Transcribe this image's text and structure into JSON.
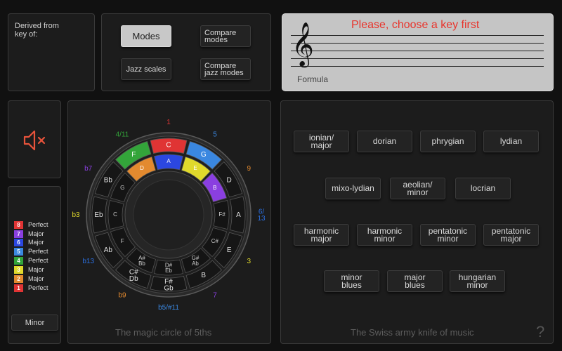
{
  "derived": {
    "label": "Derived from\nkey of:"
  },
  "mode_buttons": {
    "modes": "Modes",
    "compare_modes": "Compare\nmodes",
    "jazz_scales": "Jazz scales",
    "compare_jazz": "Compare\njazz modes"
  },
  "staff": {
    "message": "Please, choose a key first",
    "formula": "Formula",
    "message_color": "#e8342c"
  },
  "legend": {
    "items": [
      {
        "num": "8",
        "label": "Perfect",
        "color": "#e03434"
      },
      {
        "num": "7",
        "label": "Major",
        "color": "#8a3fe0"
      },
      {
        "num": "6",
        "label": "Major",
        "color": "#2b47e0"
      },
      {
        "num": "5",
        "label": "Perfect",
        "color": "#3a87e0"
      },
      {
        "num": "4",
        "label": "Perfect",
        "color": "#33a53a"
      },
      {
        "num": "3",
        "label": "Major",
        "color": "#e0d92c"
      },
      {
        "num": "2",
        "label": "Major",
        "color": "#e38a2f"
      },
      {
        "num": "1",
        "label": "Perfect",
        "color": "#e03434"
      }
    ],
    "minor_button": "Minor"
  },
  "circle": {
    "caption": "The magic circle of 5ths",
    "outer_notes": [
      "C",
      "G",
      "D",
      "A",
      "E",
      "B",
      "F#\nGb",
      "C#\nDb",
      "Ab",
      "Eb",
      "Bb",
      "F"
    ],
    "inner_notes": [
      "A",
      "E",
      "B",
      "F#",
      "C#",
      "G#\nAb",
      "D#\nEb",
      "A#\nBb",
      "F",
      "C",
      "G",
      "D"
    ],
    "intervals": [
      "1",
      "5",
      "9",
      "6/\n13",
      "3",
      "7",
      "b5/#11",
      "b9",
      "b13",
      "b3",
      "b7",
      "4/11"
    ],
    "interval_colors": [
      "#e03434",
      "#3a87e0",
      "#e38a2f",
      "#2b6fe0",
      "#e0d92c",
      "#8a3fe0",
      "#3a87e0",
      "#e38a2f",
      "#2b6fe0",
      "#e0d92c",
      "#8a3fe0",
      "#33a53a"
    ],
    "outer_colors": [
      "#e03434",
      "#3a87e0",
      "",
      "",
      "",
      "",
      "",
      "",
      "",
      "",
      "",
      "#33a53a"
    ],
    "inner_colors": [
      "#2b47e0",
      "#e0d92c",
      "#8a3fe0",
      "",
      "",
      "",
      "",
      "",
      "",
      "",
      "",
      "#e38a2f"
    ]
  },
  "scales": {
    "rows": [
      [
        "ionian/\nmajor",
        "dorian",
        "phrygian",
        "lydian"
      ],
      [
        "mixo-lydian",
        "aeolian/\nminor",
        "locrian"
      ],
      [
        "harmonic\nmajor",
        "harmonic\nminor",
        "pentatonic\nminor",
        "pentatonic\nmajor"
      ],
      [
        "minor\nblues",
        "major\nblues",
        "hungarian\nminor"
      ]
    ],
    "caption": "The Swiss army knife of music",
    "help": "?"
  },
  "icons": {
    "mute": "speaker-mute-icon",
    "treble": "treble-clef-icon",
    "help": "help-icon"
  },
  "accent": "#e8533b"
}
